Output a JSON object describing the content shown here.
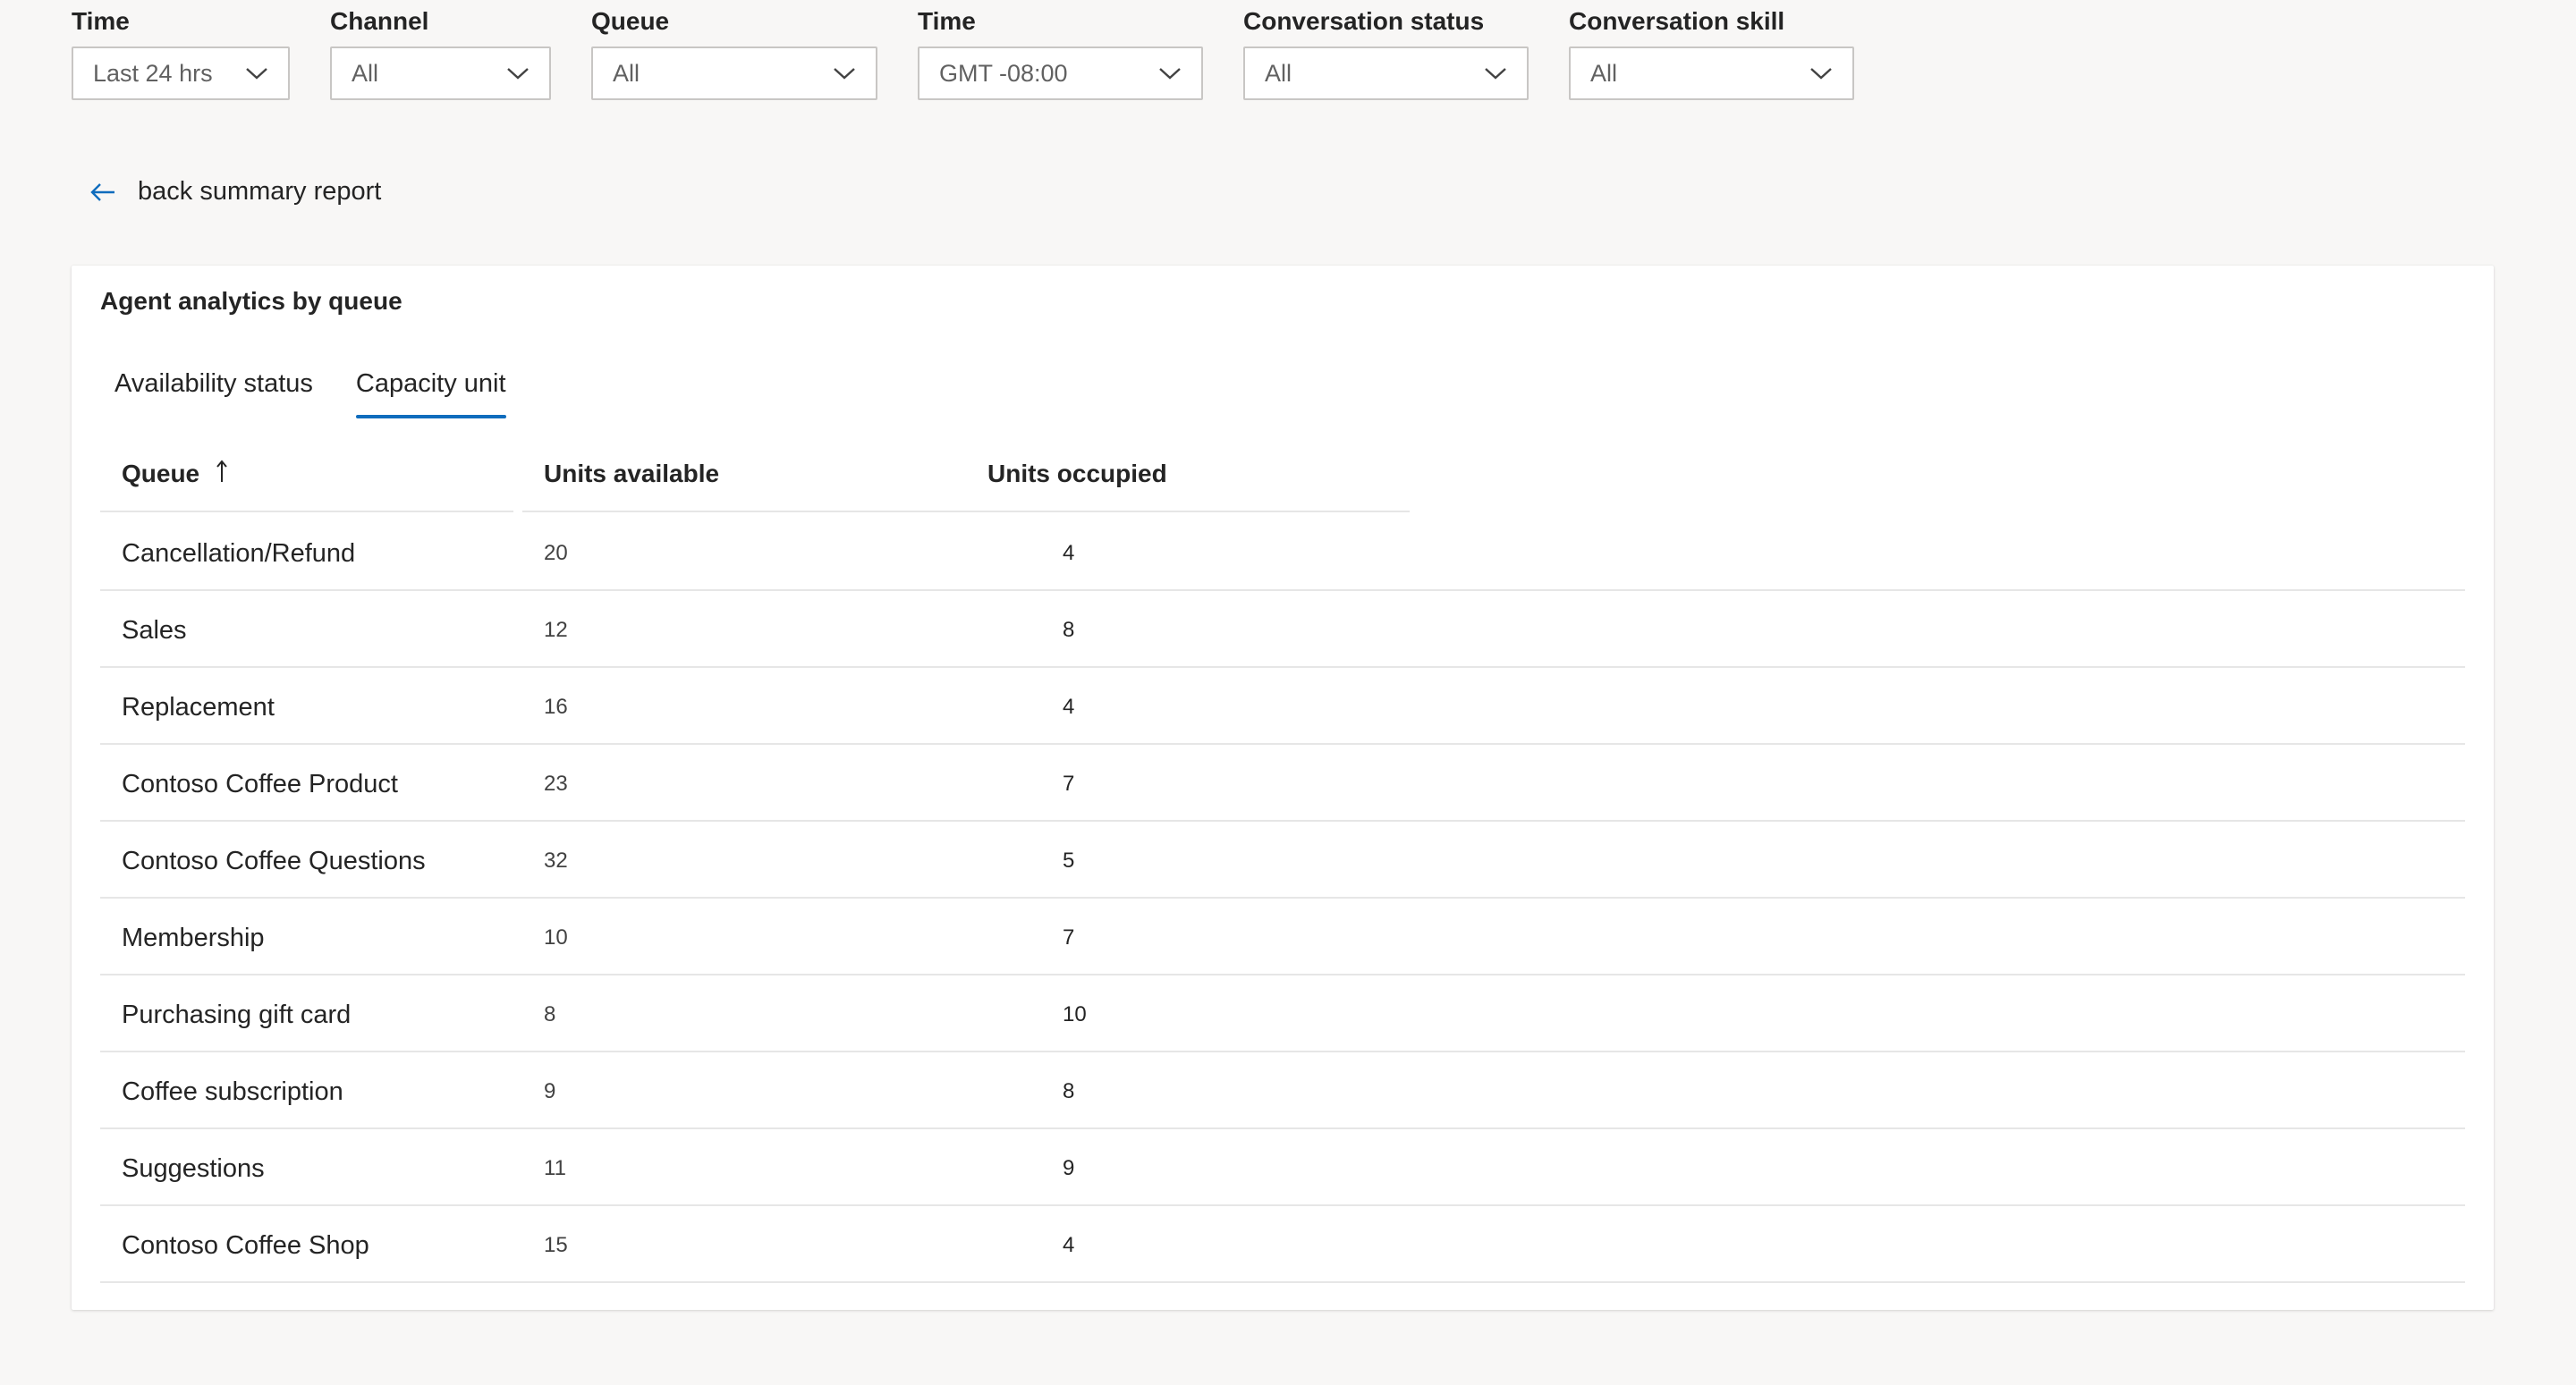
{
  "filters": [
    {
      "label": "Time",
      "value": "Last 24 hrs"
    },
    {
      "label": "Channel",
      "value": "All"
    },
    {
      "label": "Queue",
      "value": "All"
    },
    {
      "label": "Time",
      "value": "GMT -08:00"
    },
    {
      "label": "Conversation status",
      "value": "All"
    },
    {
      "label": "Conversation skill",
      "value": "All"
    }
  ],
  "back_link": {
    "label": "back summary report"
  },
  "card": {
    "title": "Agent analytics by queue",
    "tabs": [
      {
        "label": "Availability status",
        "active": false
      },
      {
        "label": "Capacity unit",
        "active": true
      }
    ],
    "table": {
      "headers": {
        "queue": "Queue",
        "units_available": "Units available",
        "units_occupied": "Units occupied"
      },
      "sort": {
        "column": "queue",
        "direction": "ascending"
      },
      "rows": [
        {
          "queue": "Cancellation/Refund",
          "available": "20",
          "occupied": "4"
        },
        {
          "queue": "Sales",
          "available": "12",
          "occupied": "8"
        },
        {
          "queue": "Replacement",
          "available": "16",
          "occupied": "4"
        },
        {
          "queue": "Contoso Coffee Product",
          "available": "23",
          "occupied": "7"
        },
        {
          "queue": "Contoso Coffee Questions",
          "available": "32",
          "occupied": "5"
        },
        {
          "queue": "Membership",
          "available": "10",
          "occupied": "7"
        },
        {
          "queue": "Purchasing gift card",
          "available": "8",
          "occupied": "10"
        },
        {
          "queue": "Coffee subscription",
          "available": "9",
          "occupied": "8"
        },
        {
          "queue": "Suggestions",
          "available": "11",
          "occupied": "9"
        },
        {
          "queue": "Contoso Coffee Shop",
          "available": "15",
          "occupied": "4"
        }
      ]
    }
  },
  "colors": {
    "accent": "#0f6cbd",
    "page_background": "#f8f7f6",
    "divider": "#e6e6e6"
  },
  "icons": {
    "dropdown": "chevron-down-icon",
    "back": "arrow-left-icon",
    "sort": "arrow-up-icon"
  }
}
